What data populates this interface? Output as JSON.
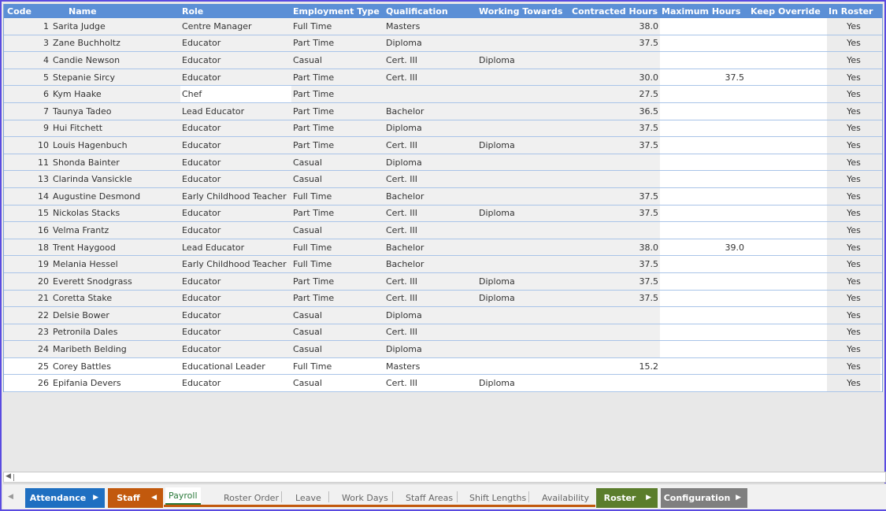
{
  "columns": {
    "code": "Code",
    "name": "Name",
    "role": "Role",
    "employment_type": "Employment Type",
    "qualification": "Qualification",
    "working_towards": "Working Towards",
    "contracted_hours": "Contracted Hours",
    "maximum_hours": "Maximum Hours",
    "keep_override": "Keep Override",
    "in_roster": "In Roster"
  },
  "rows": [
    {
      "code": "1",
      "name": "Sarita Judge",
      "role": "Centre Manager",
      "emp": "Full Time",
      "qual": "Masters",
      "work": "",
      "con": "38.0",
      "max": "",
      "keep": "",
      "roster": "Yes"
    },
    {
      "code": "3",
      "name": "Zane Buchholtz",
      "role": "Educator",
      "emp": "Part Time",
      "qual": "Diploma",
      "work": "",
      "con": "37.5",
      "max": "",
      "keep": "",
      "roster": "Yes"
    },
    {
      "code": "4",
      "name": "Candie Newson",
      "role": "Educator",
      "emp": "Casual",
      "qual": "Cert. III",
      "work": "Diploma",
      "con": "",
      "max": "",
      "keep": "",
      "roster": "Yes"
    },
    {
      "code": "5",
      "name": "Stepanie Sircy",
      "role": "Educator",
      "emp": "Part Time",
      "qual": "Cert. III",
      "work": "",
      "con": "30.0",
      "max": "37.5",
      "keep": "",
      "roster": "Yes"
    },
    {
      "code": "6",
      "name": "Kym Haake",
      "role": "Chef",
      "emp": "Part Time",
      "qual": "",
      "work": "",
      "con": "27.5",
      "max": "",
      "keep": "",
      "roster": "Yes"
    },
    {
      "code": "7",
      "name": "Taunya Tadeo",
      "role": "Lead Educator",
      "emp": "Part Time",
      "qual": "Bachelor",
      "work": "",
      "con": "36.5",
      "max": "",
      "keep": "",
      "roster": "Yes"
    },
    {
      "code": "9",
      "name": "Hui Fitchett",
      "role": "Educator",
      "emp": "Part Time",
      "qual": "Diploma",
      "work": "",
      "con": "37.5",
      "max": "",
      "keep": "",
      "roster": "Yes"
    },
    {
      "code": "10",
      "name": "Louis Hagenbuch",
      "role": "Educator",
      "emp": "Part Time",
      "qual": "Cert. III",
      "work": "Diploma",
      "con": "37.5",
      "max": "",
      "keep": "",
      "roster": "Yes"
    },
    {
      "code": "11",
      "name": "Shonda Bainter",
      "role": "Educator",
      "emp": "Casual",
      "qual": "Diploma",
      "work": "",
      "con": "",
      "max": "",
      "keep": "",
      "roster": "Yes"
    },
    {
      "code": "13",
      "name": "Clarinda Vansickle",
      "role": "Educator",
      "emp": "Casual",
      "qual": "Cert. III",
      "work": "",
      "con": "",
      "max": "",
      "keep": "",
      "roster": "Yes"
    },
    {
      "code": "14",
      "name": "Augustine Desmond",
      "role": "Early Childhood Teacher",
      "emp": "Full Time",
      "qual": "Bachelor",
      "work": "",
      "con": "37.5",
      "max": "",
      "keep": "",
      "roster": "Yes"
    },
    {
      "code": "15",
      "name": "Nickolas Stacks",
      "role": "Educator",
      "emp": "Part Time",
      "qual": "Cert. III",
      "work": "Diploma",
      "con": "37.5",
      "max": "",
      "keep": "",
      "roster": "Yes"
    },
    {
      "code": "16",
      "name": "Velma Frantz",
      "role": "Educator",
      "emp": "Casual",
      "qual": "Cert. III",
      "work": "",
      "con": "",
      "max": "",
      "keep": "",
      "roster": "Yes"
    },
    {
      "code": "18",
      "name": "Trent Haygood",
      "role": "Lead Educator",
      "emp": "Full Time",
      "qual": "Bachelor",
      "work": "",
      "con": "38.0",
      "max": "39.0",
      "keep": "",
      "roster": "Yes"
    },
    {
      "code": "19",
      "name": "Melania Hessel",
      "role": "Early Childhood Teacher",
      "emp": "Full Time",
      "qual": "Bachelor",
      "work": "",
      "con": "37.5",
      "max": "",
      "keep": "",
      "roster": "Yes"
    },
    {
      "code": "20",
      "name": "Everett Snodgrass",
      "role": "Educator",
      "emp": "Part Time",
      "qual": "Cert. III",
      "work": "Diploma",
      "con": "37.5",
      "max": "",
      "keep": "",
      "roster": "Yes"
    },
    {
      "code": "21",
      "name": "Coretta Stake",
      "role": "Educator",
      "emp": "Part Time",
      "qual": "Cert. III",
      "work": "Diploma",
      "con": "37.5",
      "max": "",
      "keep": "",
      "roster": "Yes"
    },
    {
      "code": "22",
      "name": "Delsie Bower",
      "role": "Educator",
      "emp": "Casual",
      "qual": "Diploma",
      "work": "",
      "con": "",
      "max": "",
      "keep": "",
      "roster": "Yes"
    },
    {
      "code": "23",
      "name": "Petronila Dales",
      "role": "Educator",
      "emp": "Casual",
      "qual": "Cert. III",
      "work": "",
      "con": "",
      "max": "",
      "keep": "",
      "roster": "Yes"
    },
    {
      "code": "24",
      "name": "Maribeth Belding",
      "role": "Educator",
      "emp": "Casual",
      "qual": "Diploma",
      "work": "",
      "con": "",
      "max": "",
      "keep": "",
      "roster": "Yes"
    },
    {
      "code": "25",
      "name": "Corey Battles",
      "role": "Educational Leader",
      "emp": "Full Time",
      "qual": "Masters",
      "work": "",
      "con": "15.2",
      "max": "",
      "keep": "",
      "roster": "Yes"
    },
    {
      "code": "26",
      "name": "Epifania Devers",
      "role": "Educator",
      "emp": "Casual",
      "qual": "Cert. III",
      "work": "Diploma",
      "con": "",
      "max": "",
      "keep": "",
      "roster": "Yes"
    }
  ],
  "tabs": {
    "attendance": "Attendance",
    "staff": "Staff",
    "payroll": "Payroll",
    "roster_order": "Roster Order",
    "leave": "Leave",
    "work_days": "Work Days",
    "staff_areas": "Staff Areas",
    "shift_lengths": "Shift Lengths",
    "availability": "Availability",
    "roster": "Roster",
    "configuration": "Configuration"
  },
  "colors": {
    "header_bg": "#5b8fd6",
    "attendance": "#1e6fc1",
    "staff": "#c2590d",
    "roster": "#5b7d2c",
    "configuration": "#7f7f7f",
    "frame": "#5a4be0"
  },
  "icons": {
    "tab_nav_left": "left-arrow",
    "group_expand": "right-arrow",
    "group_collapse": "left-arrow"
  }
}
